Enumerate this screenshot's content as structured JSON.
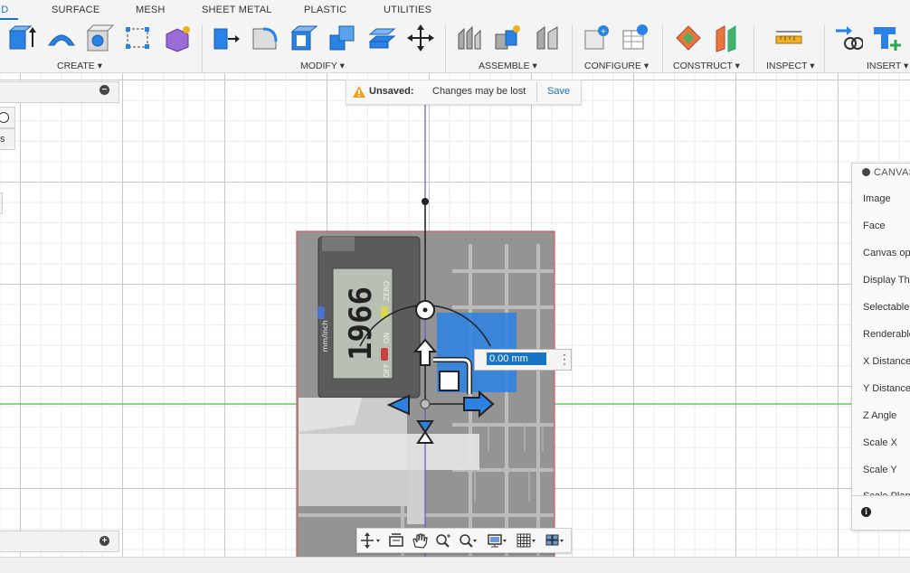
{
  "tabs": [
    "ID",
    "SURFACE",
    "MESH",
    "SHEET METAL",
    "PLASTIC",
    "UTILITIES"
  ],
  "toolbar_groups": [
    "CREATE",
    "MODIFY",
    "ASSEMBLE",
    "CONFIGURE",
    "CONSTRUCT",
    "INSPECT",
    "INSERT"
  ],
  "left_panel": {
    "minus_glyph": "−",
    "row_text": "s",
    "bottom_plus_glyph": "+"
  },
  "notification": {
    "label": "Unsaved:",
    "message": "Changes may be lost",
    "action": "Save"
  },
  "manipulator": {
    "value": "0.00 mm"
  },
  "canvas_panel": {
    "title": "CANVAS",
    "items": [
      "Image",
      "Face",
      "Canvas op",
      "Display Thr",
      "Selectable",
      "Renderable",
      "X Distance",
      "Y Distance",
      "Z Angle",
      "Scale X",
      "Scale Y",
      "Scale Plane"
    ]
  },
  "photo_text": {
    "display": "1966",
    "unit": "mm/inch",
    "zero": "ZERO",
    "on": "ON",
    "off": "OFF"
  },
  "colors": {
    "accent": "#1a74c4",
    "warning": "#f0a01e",
    "axis_x": "#2fcc2f",
    "axis_y": "#5b5bd6",
    "sel_blue": "#2a82e4"
  }
}
